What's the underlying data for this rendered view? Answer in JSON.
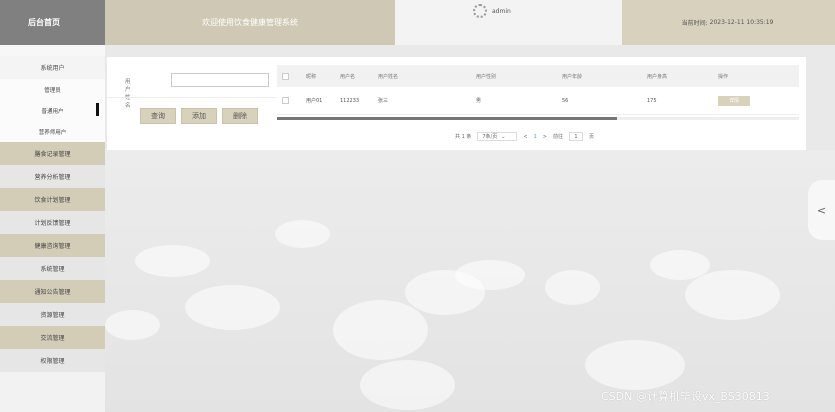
{
  "header": {
    "brand": "后台首页",
    "welcome": "欢迎使用饮食健康管理系统",
    "username": "admin",
    "time_label": "当前时间:",
    "time_value": "2023-12-11 10:35:19"
  },
  "sidebar": {
    "items": [
      {
        "label": "系统用户",
        "style": "white"
      },
      {
        "label": "管理员",
        "style": "sub"
      },
      {
        "label": "普通用户",
        "style": "sub"
      },
      {
        "label": "营养师用户",
        "style": "sub"
      },
      {
        "label": "膳食记录管理",
        "style": "dark"
      },
      {
        "label": "营养分析管理",
        "style": "light"
      },
      {
        "label": "饮食计划管理",
        "style": "dark"
      },
      {
        "label": "计划反馈管理",
        "style": "light"
      },
      {
        "label": "健康咨询管理",
        "style": "dark"
      },
      {
        "label": "系统管理",
        "style": "light"
      },
      {
        "label": "通知公告管理",
        "style": "dark"
      },
      {
        "label": "资源管理",
        "style": "light"
      },
      {
        "label": "交流管理",
        "style": "dark"
      },
      {
        "label": "权限管理",
        "style": "light"
      }
    ]
  },
  "search": {
    "label": "用户姓名",
    "value": "",
    "buttons": {
      "query": "查询",
      "add": "添加",
      "delete": "删除"
    }
  },
  "table": {
    "headers": [
      "昵称",
      "用户名",
      "用户姓名",
      "用户性别",
      "用户年龄",
      "用户身高",
      "操作"
    ],
    "rows": [
      {
        "nickname": "用户01",
        "username": "112233",
        "name": "张三",
        "gender": "男",
        "age": "56",
        "height": "175",
        "action": "详情"
      }
    ]
  },
  "pager": {
    "total": "共 1 条",
    "page_size": "7条/页",
    "prev": "<",
    "current": "1",
    "next": ">",
    "goto": "前往",
    "goto_value": "1",
    "page_unit": "页"
  },
  "side_toggle": "<",
  "watermark": "CSDN @计算机毕设vx_BS30813",
  "colors": {
    "accent": "#d3cdb8",
    "brand_bg": "#808080",
    "link": "#409eff"
  }
}
